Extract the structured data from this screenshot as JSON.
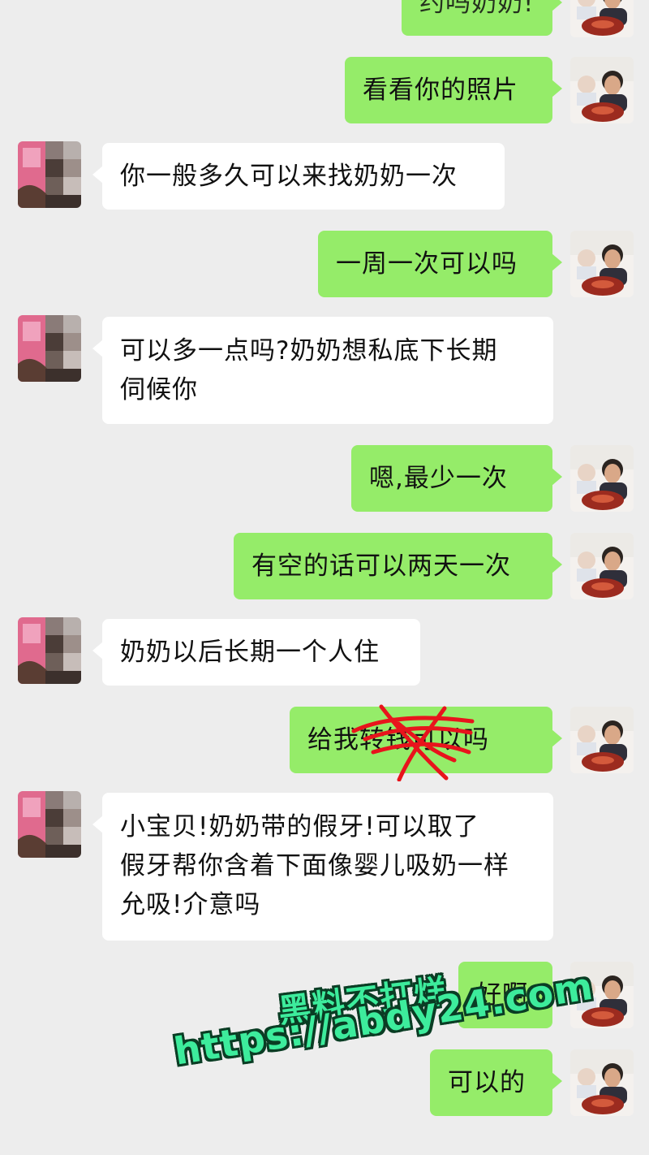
{
  "messages": [
    {
      "side": "right",
      "text": "约吗奶奶!",
      "partial": true
    },
    {
      "side": "right",
      "text": "看看你的照片"
    },
    {
      "side": "left",
      "text": "你一般多久可以来找奶奶一次"
    },
    {
      "side": "right",
      "text": "一周一次可以吗"
    },
    {
      "side": "left",
      "lines": [
        "可以多一点吗?奶奶想私底下长期",
        "伺候你"
      ]
    },
    {
      "side": "right",
      "text": "嗯,最少一次"
    },
    {
      "side": "right",
      "text": "有空的话可以两天一次"
    },
    {
      "side": "left",
      "text": "奶奶以后长期一个人住"
    },
    {
      "side": "right",
      "text": "给我转钱可以吗"
    },
    {
      "side": "left",
      "lines": [
        "小宝贝!奶奶带的假牙!可以取了",
        "假牙帮你含着下面像婴儿吸奶一样",
        "允吸!介意吗"
      ]
    },
    {
      "side": "right",
      "text": "好啊"
    },
    {
      "side": "right",
      "text": "可以的"
    }
  ],
  "watermark": {
    "line1": "黑料不打烊",
    "line2": "https://abdy24.com"
  },
  "colors": {
    "background": "#ededed",
    "bubble_self": "#95ec69",
    "bubble_other": "#ffffff",
    "scribble": "#e8141c",
    "watermark": "#3dec9c"
  }
}
